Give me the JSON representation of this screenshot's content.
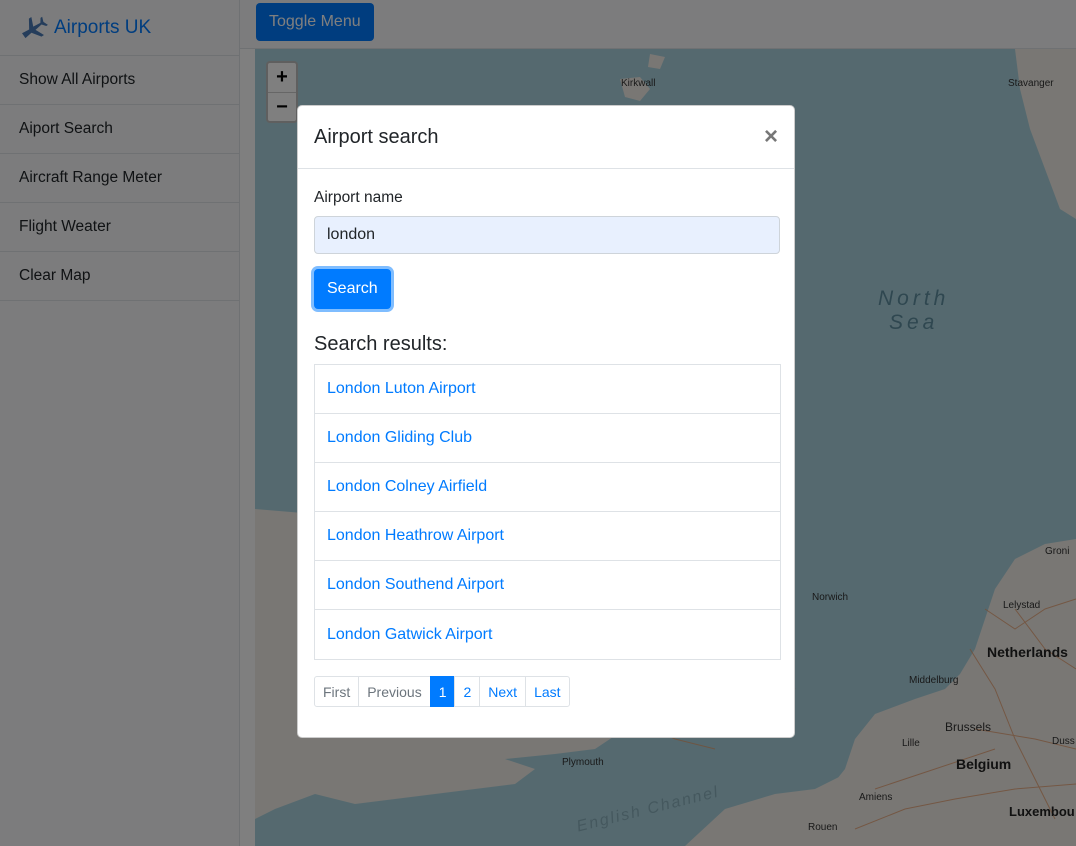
{
  "sidebar": {
    "brand": "Airports UK",
    "items": [
      {
        "label": "Show All Airports"
      },
      {
        "label": "Aiport Search"
      },
      {
        "label": "Aircraft Range Meter"
      },
      {
        "label": "Flight Weater"
      },
      {
        "label": "Clear Map"
      }
    ]
  },
  "topbar": {
    "toggle_label": "Toggle Menu"
  },
  "map": {
    "zoom_in": "+",
    "zoom_out": "−",
    "labels": {
      "kirkwall": "Kirkwall",
      "stavanger": "Stavanger",
      "north_sea_1": "North",
      "north_sea_2": "Sea",
      "groningen": "Groni",
      "lelystad": "Lelystad",
      "netherlands": "Netherlands",
      "norwich": "Norwich",
      "middelburg": "Middelburg",
      "brussels": "Brussels",
      "lille": "Lille",
      "belgium": "Belgium",
      "plymouth": "Plymouth",
      "english_channel": "English Channel",
      "amiens": "Amiens",
      "rouen": "Rouen",
      "luxembourg": "Luxembou",
      "dusseldorf": "Duss"
    }
  },
  "modal": {
    "title": "Airport search",
    "close": "×",
    "field_label": "Airport name",
    "input_value": "london",
    "search_label": "Search",
    "results_title": "Search results:",
    "results": [
      "London Luton Airport",
      "London Gliding Club",
      "London Colney Airfield",
      "London Heathrow Airport",
      "London Southend Airport",
      "London Gatwick Airport"
    ],
    "pagination": {
      "first": "First",
      "previous": "Previous",
      "page1": "1",
      "page2": "2",
      "next": "Next",
      "last": "Last"
    }
  },
  "colors": {
    "accent": "#007bff",
    "sea": "#aad3df",
    "land": "#f2efe9"
  }
}
